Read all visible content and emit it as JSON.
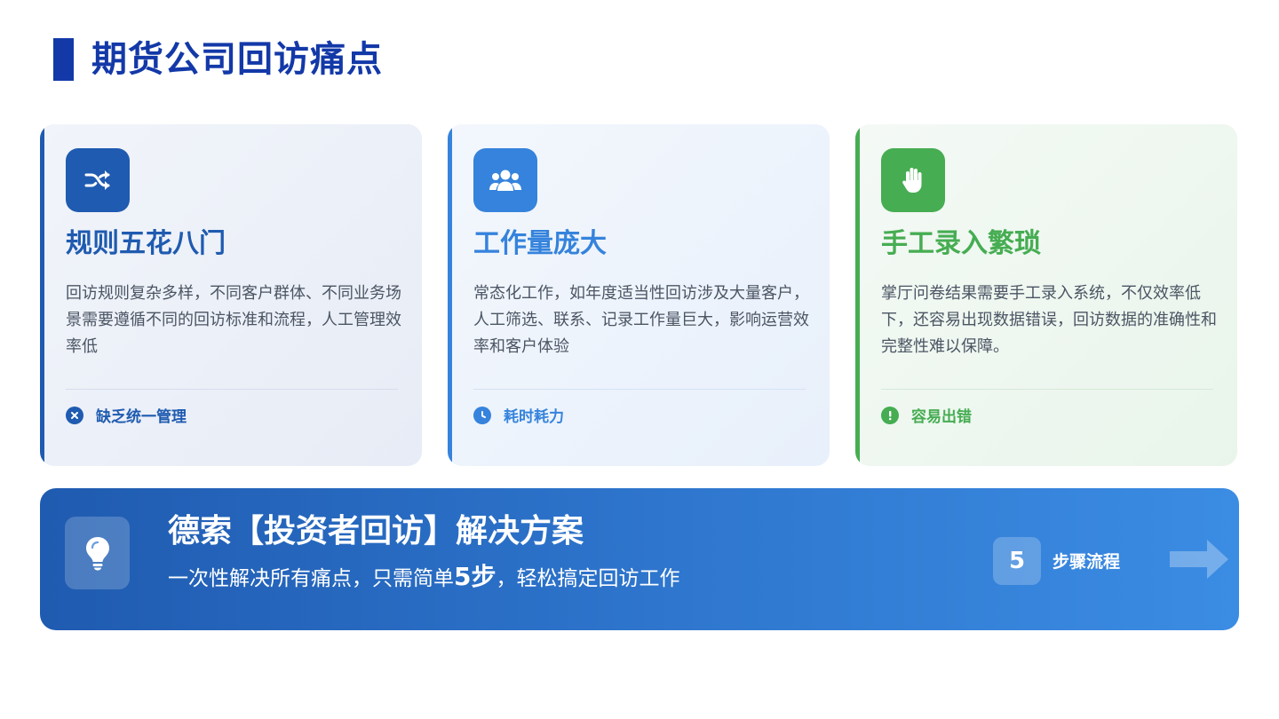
{
  "page": {
    "title": "期货公司回访痛点"
  },
  "colors": {
    "title": "#1339a8",
    "dark_blue": "#1f5bb0",
    "light_blue": "#3583dc",
    "green": "#46ad52"
  },
  "cards": [
    {
      "icon": "shuffle-icon",
      "title": "规则五花八门",
      "desc": "回访规则复杂多样，不同客户群体、不同业务场景需要遵循不同的回访标准和流程，人工管理效率低",
      "tag_icon": "x-circle-icon",
      "tag": "缺乏统一管理"
    },
    {
      "icon": "users-icon",
      "title": "工作量庞大",
      "desc": "常态化工作，如年度适当性回访涉及大量客户，人工筛选、联系、记录工作量巨大，影响运营效率和客户体验",
      "tag_icon": "clock-icon",
      "tag": "耗时耗力"
    },
    {
      "icon": "hand-icon",
      "title": "手工录入繁琐",
      "desc": "掌厅问卷结果需要手工录入系统，不仅效率低下，还容易出现数据错误，回访数据的准确性和完整性难以保障。",
      "tag_icon": "exclamation-circle-icon",
      "tag": "容易出错"
    }
  ],
  "banner": {
    "icon": "lightbulb-icon",
    "title": "德索【投资者回访】解决方案",
    "sub_prefix": "一次性解决所有痛点，只需简单",
    "sub_highlight": "5步",
    "sub_suffix": "，轻松搞定回访工作",
    "step_number": "5",
    "step_label": "步骤流程",
    "arrow_icon": "arrow-right-icon"
  }
}
